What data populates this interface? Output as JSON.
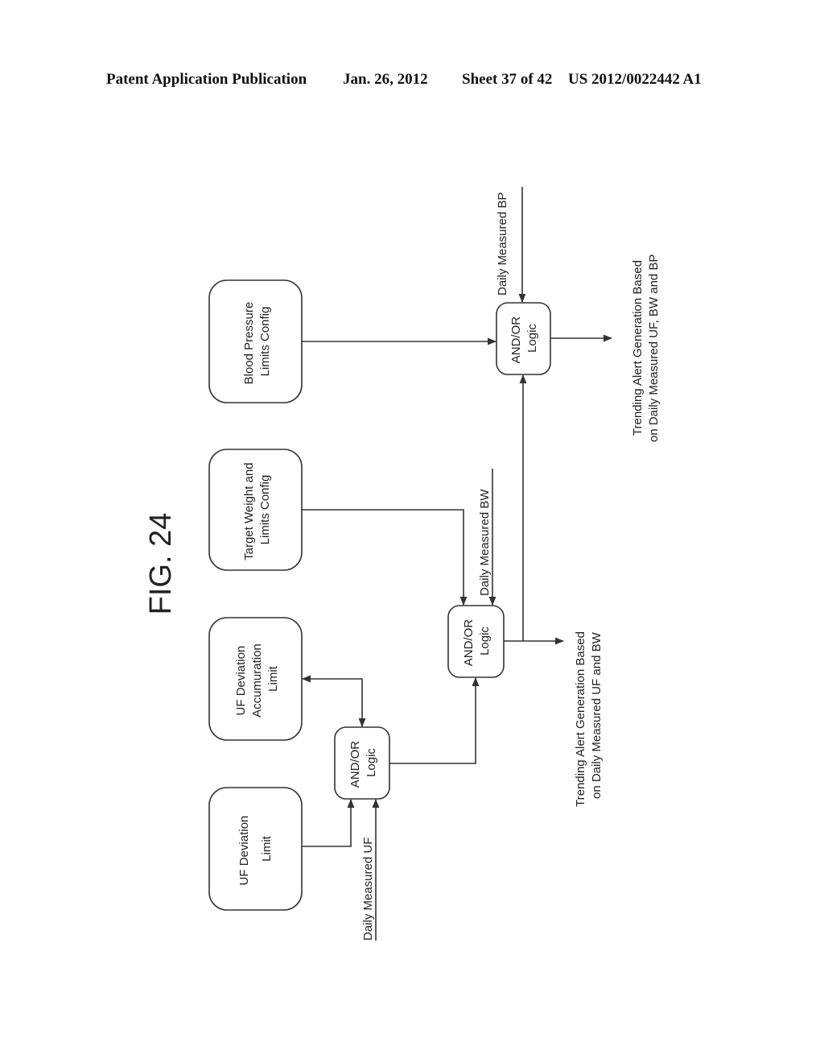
{
  "header": {
    "publication": "Patent Application Publication",
    "date": "Jan. 26, 2012",
    "sheet": "Sheet 37 of 42",
    "number": "US 2012/0022442 A1"
  },
  "figure": {
    "label": "FIG. 24"
  },
  "boxes": {
    "bp_limits": {
      "line1": "Blood Pressure",
      "line2": "Limits Config"
    },
    "target_weight": {
      "line1": "Target Weight and",
      "line2": "Limits Config"
    },
    "uf_accum": {
      "line1": "UF Deviation",
      "line2": "Accumuration",
      "line3": "Limit"
    },
    "uf_limit": {
      "line1": "UF Deviation",
      "line2": "Limit"
    }
  },
  "logic": {
    "line1": "AND/OR",
    "line2": "Logic"
  },
  "inputs": {
    "uf": "Daily Measured UF",
    "bw": "Daily Measured BW",
    "bp": "Daily Measured BP"
  },
  "outputs": {
    "uf_bw": {
      "line1": "Trending Alert Generation Based",
      "line2": "on Daily Measured UF and BW"
    },
    "uf_bw_bp": {
      "line1": "Trending Alert Generation Based",
      "line2": "on Daily Measured UF, BW and BP"
    }
  },
  "colors": {
    "stroke": "#333333",
    "text": "#222222"
  }
}
